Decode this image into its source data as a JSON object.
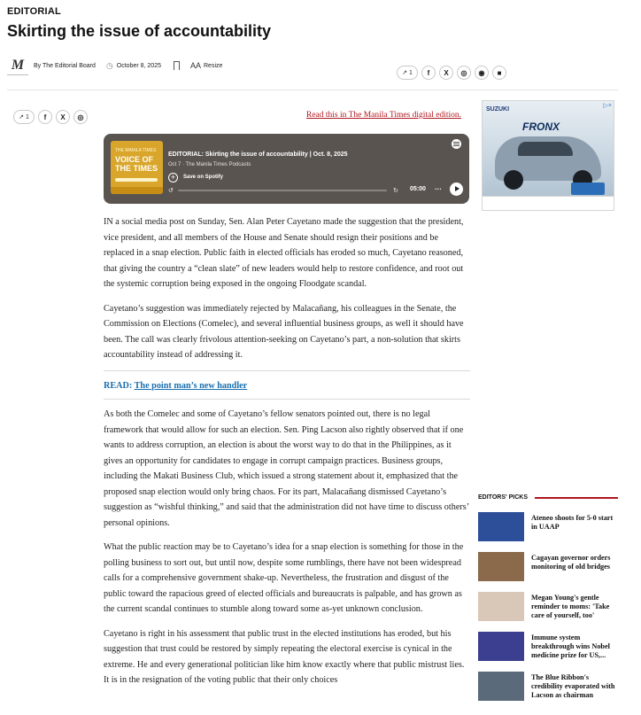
{
  "header": {
    "section": "EDITORIAL",
    "title": "Skirting the issue of accountability",
    "logo_glyph": "M",
    "byline": "By The Editorial Board",
    "date": "October 8, 2025",
    "resize_label": "Resize",
    "resize_glyph": "AA"
  },
  "share": {
    "top": {
      "share_count": "1"
    },
    "left": {
      "share_count": "1"
    },
    "glyphs": {
      "facebook": "f",
      "x": "X",
      "whatsapp": "◎",
      "instagram": "◉",
      "message": "■"
    }
  },
  "digital_edition_link": "Read this in The Manila Times digital edition.",
  "player": {
    "cover_kicker": "THE MANILA TIMES",
    "cover_title": "VOICE OF THE TIMES",
    "episode_title": "EDITORIAL: Skirting the issue of accountability | Oct. 8, 2025",
    "subtitle": "Oct 7 · The Manila Times Podcasts",
    "save_label": "Save on Spotify",
    "time": "05:00",
    "more": "···",
    "progress": 0
  },
  "article": {
    "p1": "IN a social media post on Sunday, Sen. Alan Peter Cayetano made the suggestion that the president, vice president, and all members of the House and Senate should resign their positions and be replaced in a snap election. Public faith in elected officials has eroded so much, Cayetano reasoned, that giving the country a “clean slate” of new leaders would help to restore confidence, and root out the systemic corruption being exposed in the ongoing Floodgate scandal.",
    "p2": "Cayetano’s suggestion was immediately rejected by Malacañang, his colleagues in the Senate, the Commission on Elections (Comelec), and several influential business groups, as well it should have been. The call was clearly frivolous attention-seeking on Cayetano’s part, a non-solution that skirts accountability instead of addressing it.",
    "read_label": "READ:",
    "read_link": "The point man’s new handler",
    "p3": "As both the Comelec and some of Cayetano’s fellow senators pointed out, there is no legal framework that would allow for such an election. Sen. Ping Lacson also rightly observed that if one wants to address corruption, an election is about the worst way to do that in the Philippines, as it gives an opportunity for candidates to engage in corrupt campaign practices. Business groups, including the Makati Business Club, which issued a strong statement about it, emphasized that the proposed snap election would only bring chaos. For its part, Malacañang dismissed Cayetano’s suggestion as “wishful thinking,” and said that the administration did not have time to discuss others’ personal opinions.",
    "p4": "What the public reaction may be to Cayetano’s idea for a snap election is something for those in the polling business to sort out, but until now, despite some rumblings, there have not been widespread calls for a comprehensive government shake-up. Nevertheless, the frustration and disgust of the public toward the rapacious greed of elected officials and bureaucrats is palpable, and has grown as the current scandal continues to stumble along toward some as-yet unknown conclusion.",
    "p5": "Cayetano is right in his assessment that public trust in the elected institutions has eroded, but his suggestion that trust could be restored by simply repeating the electoral exercise is cynical in the extreme. He and every generational politician like him know exactly where that public mistrust lies. It is in the resignation of the voting public that their only choices"
  },
  "ad": {
    "brand": "SUZUKI",
    "model": "FRONX",
    "marker": "▷×"
  },
  "editors_picks": {
    "heading": "EDITORS' PICKS",
    "accent": "#b0161e",
    "items": [
      {
        "title": "Ateneo shoots for 5-0 start in UAAP",
        "thumb_color": "#2d4f9a"
      },
      {
        "title": "Cagayan governor orders monitoring of old bridges",
        "thumb_color": "#8a6a4a"
      },
      {
        "title": "Megan Young's gentle reminder to moms: 'Take care of yourself, too'",
        "thumb_color": "#d9c8b8"
      },
      {
        "title": "Immune system breakthrough wins Nobel medicine prize for US,...",
        "thumb_color": "#3c3f8f"
      },
      {
        "title": "The Blue Ribbon's credibility evaporated with Lacson as chairman",
        "thumb_color": "#5a6a7a"
      }
    ]
  }
}
